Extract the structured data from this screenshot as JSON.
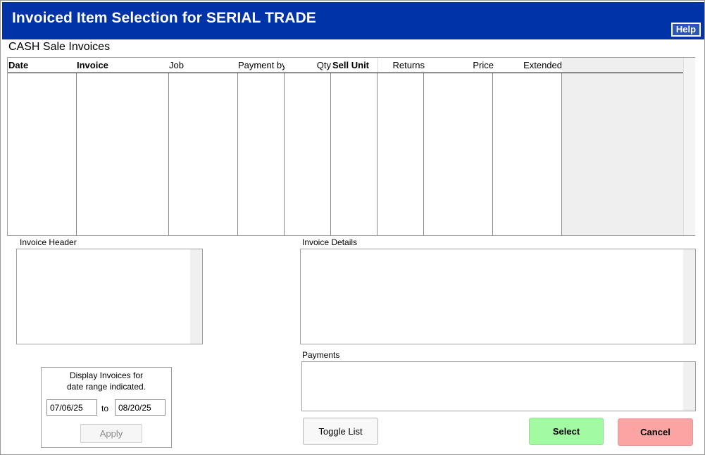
{
  "window": {
    "title": "Invoiced Item Selection for SERIAL TRADE",
    "help_label": "Help",
    "colors": {
      "titlebar": "#0033a8",
      "select_button": "#a2fba2",
      "cancel_button": "#fca3a3"
    }
  },
  "invoices": {
    "section_title": "CASH Sale Invoices",
    "columns": [
      "Date",
      "Invoice",
      "Job",
      "Payment by",
      "Qty",
      "Sell Unit",
      "Returns",
      "Price",
      "Extended"
    ],
    "rows": []
  },
  "invoice_header": {
    "label": "Invoice Header"
  },
  "invoice_details": {
    "label": "Invoice Details"
  },
  "payments": {
    "label": "Payments"
  },
  "date_range": {
    "line1": "Display Invoices for",
    "line2": "date range indicated.",
    "from": "07/06/25",
    "to_label": "to",
    "to": "08/20/25",
    "apply_label": "Apply"
  },
  "actions": {
    "toggle_label": "Toggle List",
    "select_label": "Select",
    "cancel_label": "Cancel"
  }
}
